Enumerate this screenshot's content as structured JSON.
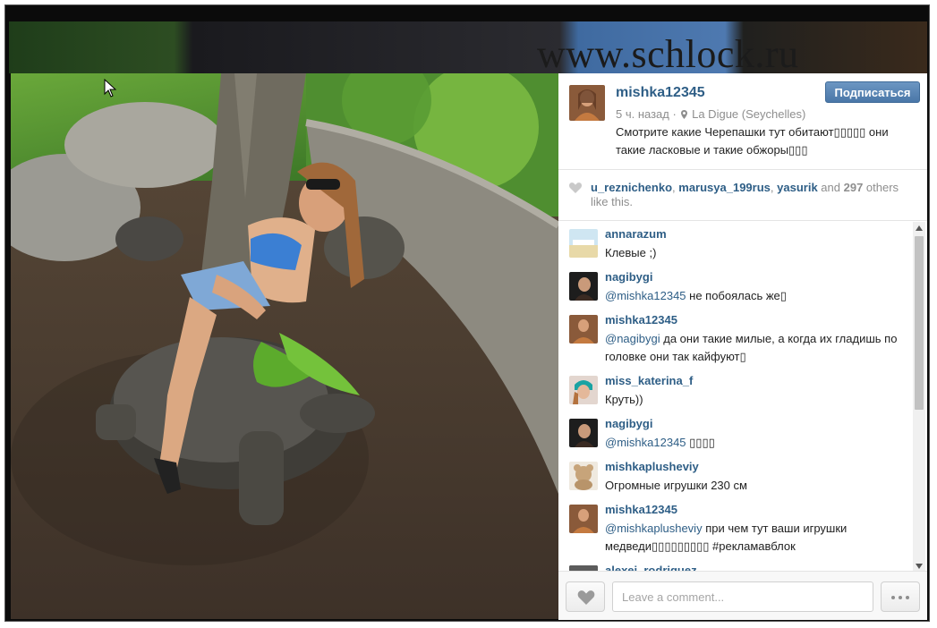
{
  "watermark": "www.schlock.ru",
  "post": {
    "username": "mishka12345",
    "follow_label": "Подписаться",
    "time_ago": "5 ч. назад",
    "separator": "·",
    "location": "La Digue (Seychelles)",
    "caption": "Смотрите какие Черепашки тут обитают▯▯▯▯▯ они такие ласковые и такие обжоры▯▯▯"
  },
  "likes": {
    "users": [
      "u_reznichenko",
      "marusya_199rus",
      "yasurik"
    ],
    "sep1": ", ",
    "sep2": ", ",
    "and_text": " and ",
    "count": "297",
    "suffix": " others like this."
  },
  "comments": [
    {
      "user": "annarazum",
      "mention": "",
      "text": "Клевые ;)",
      "avatar": "annarazum"
    },
    {
      "user": "nagibygi",
      "mention": "@mishka12345",
      "text": " не побоялась же▯",
      "avatar": "nagibygi"
    },
    {
      "user": "mishka12345",
      "mention": "@nagibygi",
      "text": " да они такие милые, а когда их гладишь по головке они так кайфуют▯",
      "avatar": "mishka12345"
    },
    {
      "user": "miss_katerina_f",
      "mention": "",
      "text": "Круть))",
      "avatar": "miss_katerina_f"
    },
    {
      "user": "nagibygi",
      "mention": "@mishka12345",
      "text": " ▯▯▯▯",
      "avatar": "nagibygi"
    },
    {
      "user": "mishkaplusheviy",
      "mention": "",
      "text": "Огромные игрушки 230 см",
      "avatar": "mishkaplusheviy"
    },
    {
      "user": "mishka12345",
      "mention": "@mishkaplusheviy",
      "text": " при чем тут ваши игрушки медведи▯▯▯▯▯▯▯▯▯ #рекламавблок",
      "avatar": "mishka12345"
    },
    {
      "user": "alexei_rodriguez",
      "mention": "",
      "text": "",
      "avatar": "alexei_rodriguez"
    }
  ],
  "footer": {
    "comment_placeholder": "Leave a comment...",
    "comment_value": ""
  },
  "colors": {
    "username": "#2e5e86",
    "follow_button": "#4a77a8",
    "meta": "#8e8e8e"
  },
  "icons": {
    "heart": "heart-icon",
    "pin": "location-pin-icon",
    "more": "more-dots-icon"
  }
}
